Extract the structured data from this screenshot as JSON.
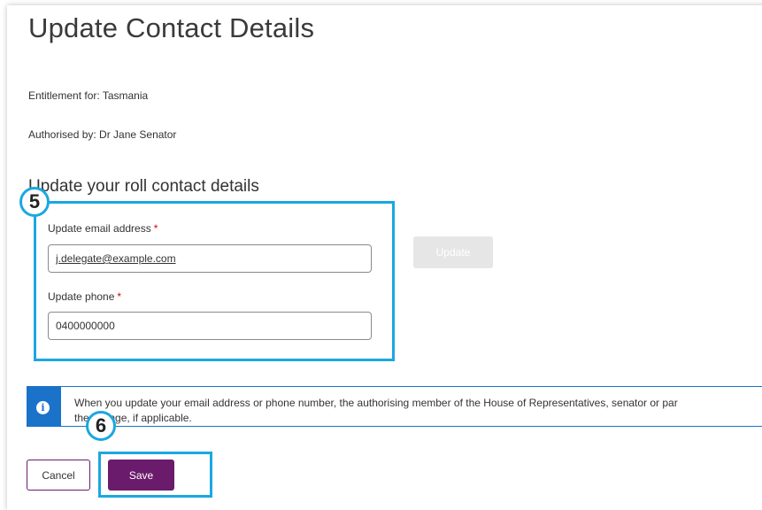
{
  "page": {
    "title": "Update Contact Details",
    "entitlement": "Entitlement for: Tasmania",
    "authorised_by": "Authorised by: Dr Jane Senator"
  },
  "section": {
    "heading": "Update your roll contact details"
  },
  "callouts": {
    "step_5": "5",
    "step_6": "6",
    "color": "#1ba7e1"
  },
  "form": {
    "email_label": "Update email address",
    "email_value": "j.delegate@example.com",
    "phone_label": "Update phone",
    "phone_value": "0400000000",
    "required_marker": "*",
    "update_button": "Update"
  },
  "info": {
    "icon": "info-icon",
    "line1": "When you update your email address or phone number, the authorising member of the House of Representatives, senator or par",
    "line2": "the change, if applicable."
  },
  "actions": {
    "cancel_label": "Cancel",
    "save_label": "Save",
    "primary_color": "#6a1b6b"
  }
}
